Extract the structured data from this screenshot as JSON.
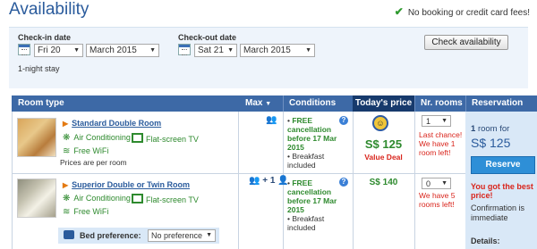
{
  "header": {
    "title": "Availability",
    "no_fees": "No booking or credit card fees!"
  },
  "search": {
    "checkin_label": "Check-in date",
    "checkin_day": "Fri 20",
    "checkin_month": "March 2015",
    "checkout_label": "Check-out date",
    "checkout_day": "Sat 21",
    "checkout_month": "March 2015",
    "check_button": "Check availability",
    "nights": "1-night stay"
  },
  "table": {
    "headers": {
      "room_type": "Room type",
      "max": "Max",
      "conditions": "Conditions",
      "price": "Today's price",
      "nr_rooms": "Nr. rooms",
      "reservation": "Reservation"
    },
    "rooms": [
      {
        "name": "Standard Double Room",
        "features": [
          "Air Conditioning",
          "Flat-screen TV",
          "Free WiFi"
        ],
        "note": "Prices are per room",
        "max_label": "",
        "cond_free": "FREE cancellation before 17 Mar 2015",
        "cond_breakfast": "Breakfast included",
        "price": "S$ 125",
        "price_note": "Value Deal",
        "nr_value": "1",
        "nr_note": "Last chance! We have 1 room left!"
      },
      {
        "name": "Superior Double or Twin Room",
        "features": [
          "Air Conditioning",
          "Flat-screen TV",
          "Free WiFi"
        ],
        "max_label": "+ 1",
        "cond_free": "FREE cancellation before 17 Mar 2015",
        "cond_breakfast": "Breakfast included",
        "price": "S$ 140",
        "nr_value": "0",
        "nr_note": "We have 5 rooms left!",
        "bed_label": "Bed preference:",
        "bed_value": "No preference"
      }
    ]
  },
  "reservation": {
    "count_num": "1",
    "count_text": "room for",
    "total": "S$ 125",
    "button": "Reserve",
    "best_price": "You got the best price!",
    "confirmation": "Confirmation is immediate",
    "details": "Details:"
  }
}
